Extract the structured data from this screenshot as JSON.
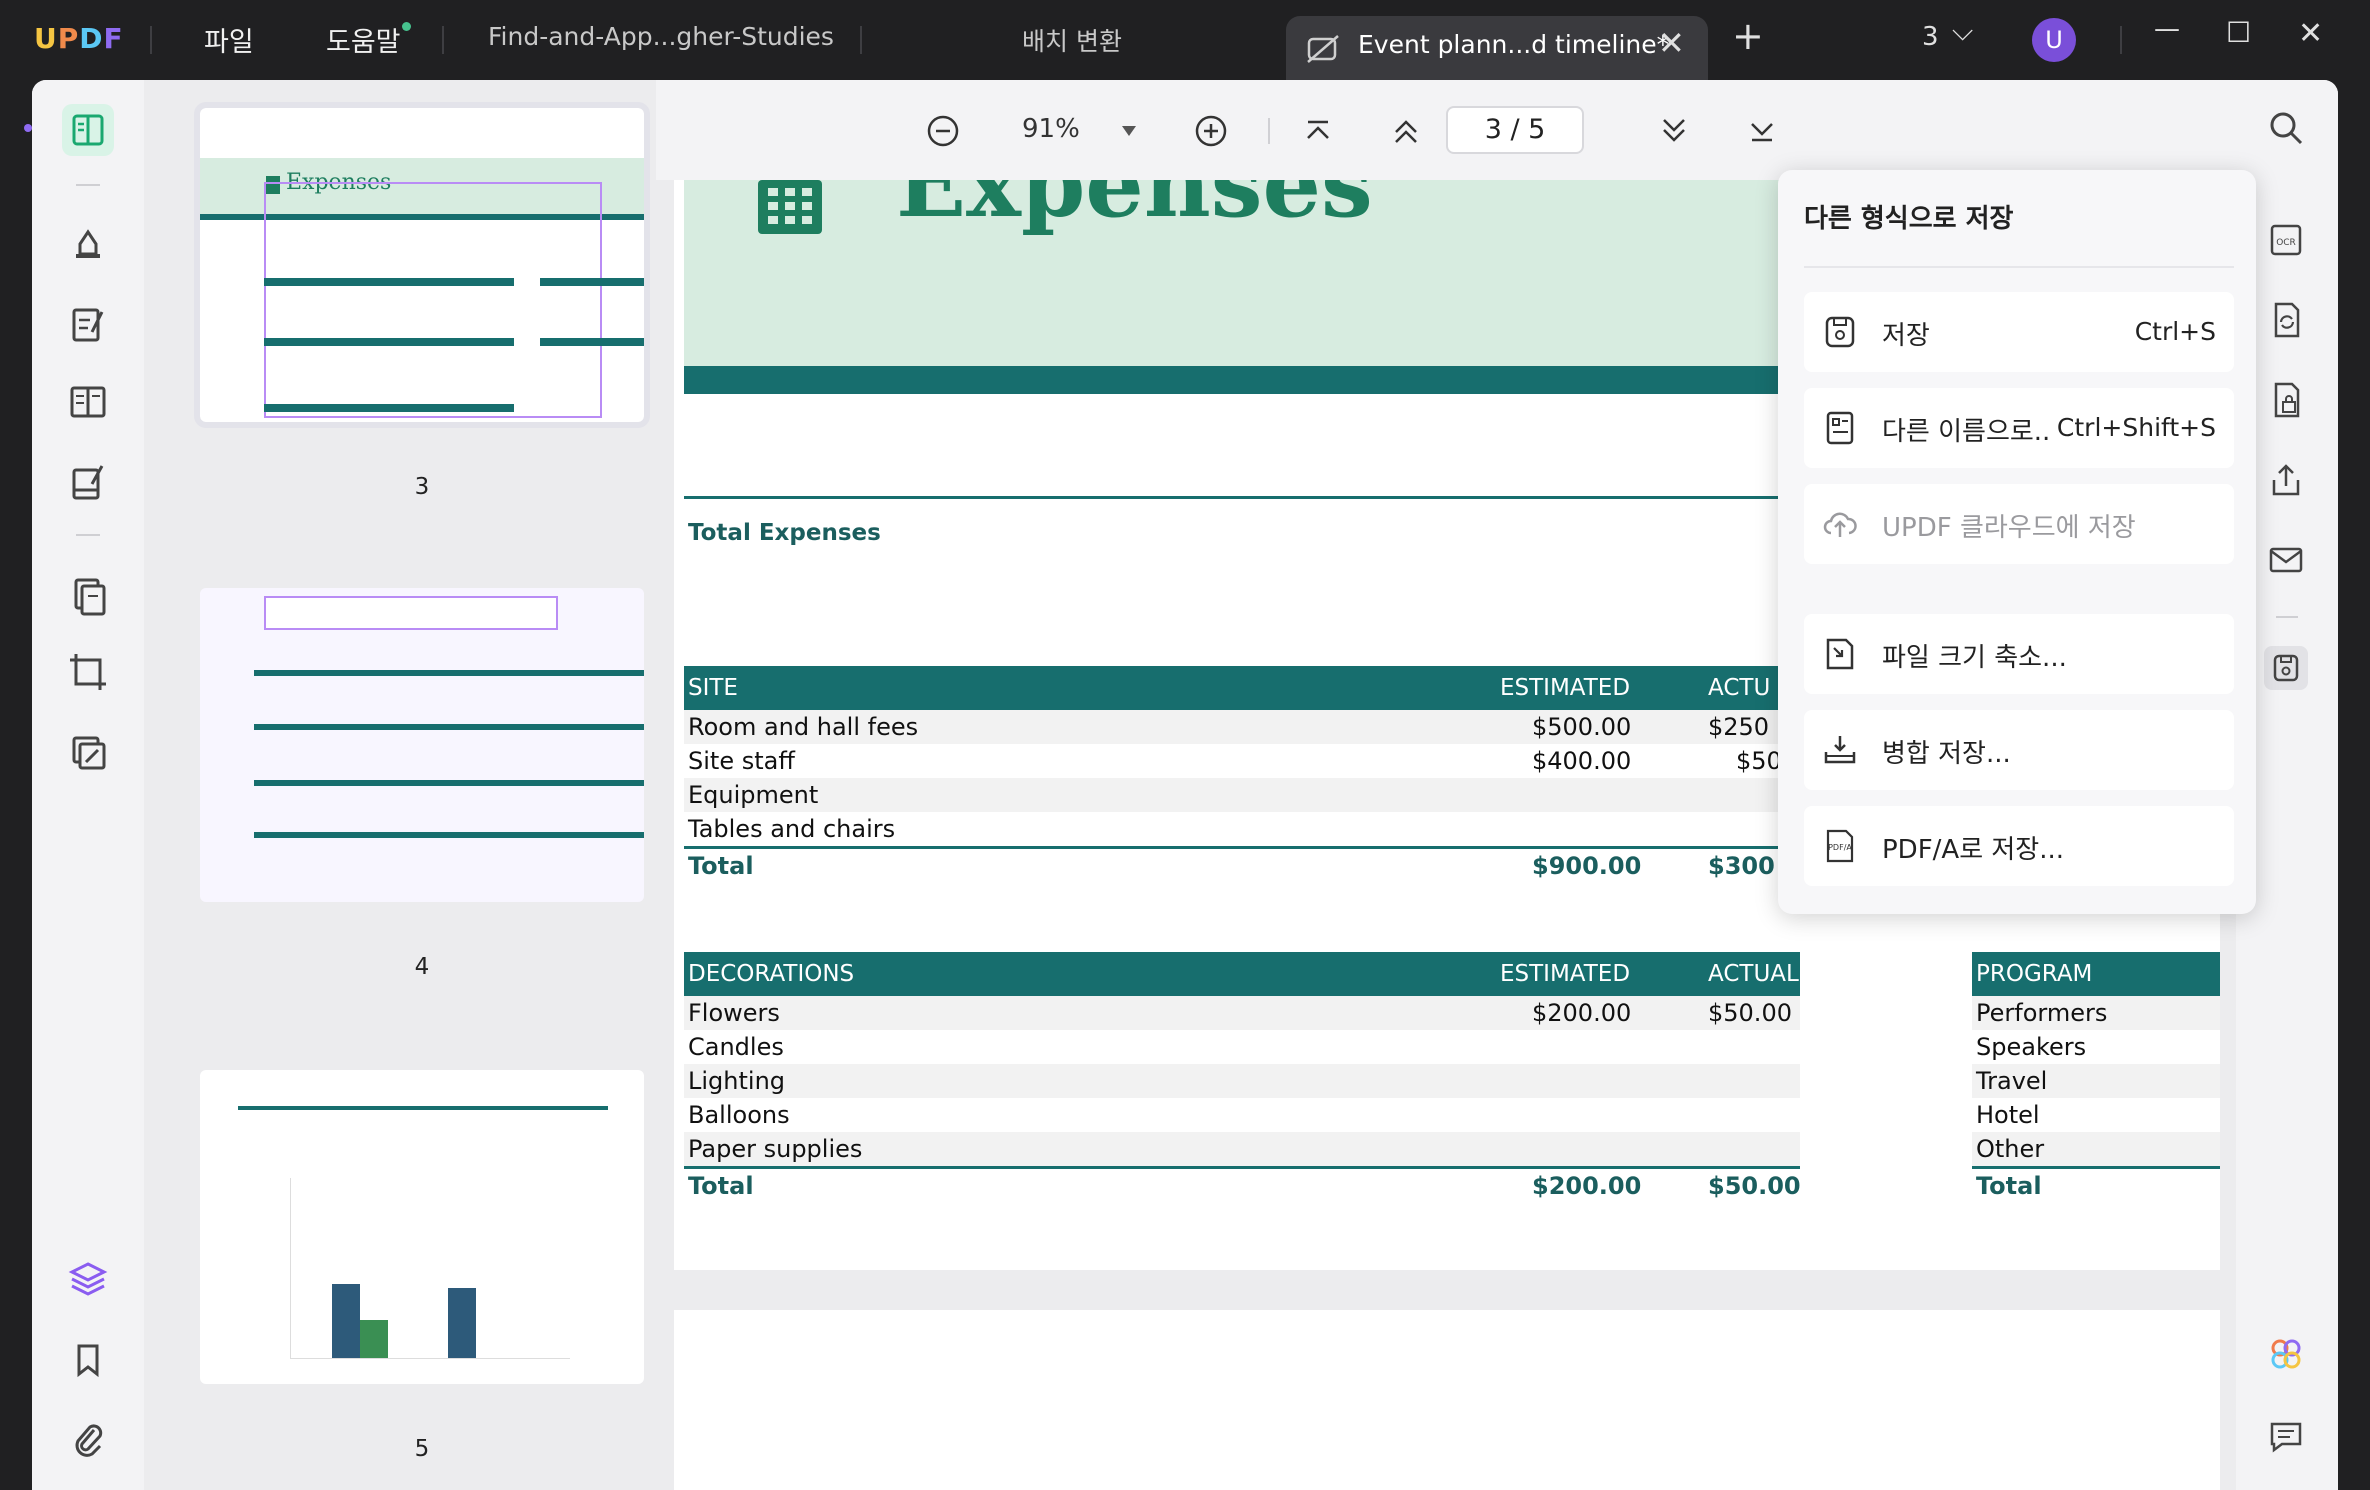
{
  "titlebar": {
    "logo": "UPDF",
    "menu_file": "파일",
    "menu_help": "도움말",
    "tab1": "Find-and-App...gher-Studies",
    "tab2": "배치 변환",
    "active_tab": "Event plann...d timeline*",
    "tab_count": "3",
    "avatar": "U",
    "close_glyph": "✕",
    "add_glyph": "+",
    "minimize_glyph": "—",
    "maximize_glyph": "☐",
    "chevron_glyph": "⌵"
  },
  "thumbnails": [
    {
      "page": "3",
      "title": "Expenses"
    },
    {
      "page": "4"
    },
    {
      "page": "5"
    }
  ],
  "toolbar": {
    "zoom": "91%",
    "page_indicator": "3 / 5"
  },
  "document": {
    "header_title": "Expenses",
    "total_expenses": "Total Expenses",
    "site_table": {
      "headers": [
        "SITE",
        "ESTIMATED",
        "ACTU"
      ],
      "rows": [
        [
          "Room and hall fees",
          "$500.00",
          "$250"
        ],
        [
          "Site staff",
          "$400.00",
          "$50"
        ],
        [
          "Equipment",
          "",
          ""
        ],
        [
          "Tables and chairs",
          "",
          ""
        ]
      ],
      "total": [
        "Total",
        "$900.00",
        "$300"
      ]
    },
    "decorations_table": {
      "headers": [
        "DECORATIONS",
        "ESTIMATED",
        "ACTUAL"
      ],
      "rows": [
        [
          "Flowers",
          "$200.00",
          "$50.00"
        ],
        [
          "Candles",
          "",
          ""
        ],
        [
          "Lighting",
          "",
          ""
        ],
        [
          "Balloons",
          "",
          ""
        ],
        [
          "Paper supplies",
          "",
          ""
        ]
      ],
      "total": [
        "Total",
        "$200.00",
        "$50.00"
      ]
    },
    "program_table": {
      "headers": [
        "PROGRAM"
      ],
      "rows": [
        [
          "Performers"
        ],
        [
          "Speakers"
        ],
        [
          "Travel"
        ],
        [
          "Hotel"
        ],
        [
          "Other"
        ]
      ],
      "total": [
        "Total"
      ]
    }
  },
  "save_menu": {
    "title": "다른 형식으로 저장",
    "items": [
      {
        "label": "저장",
        "shortcut": "Ctrl+S",
        "icon": "save-icon"
      },
      {
        "label": "다른 이름으로..",
        "shortcut": "Ctrl+Shift+S",
        "icon": "save-as-icon"
      },
      {
        "label": "UPDF 클라우드에 저장",
        "shortcut": "",
        "icon": "cloud-upload-icon"
      },
      {
        "label": "파일 크기 축소...",
        "shortcut": "",
        "icon": "compress-icon"
      },
      {
        "label": "병합 저장...",
        "shortcut": "",
        "icon": "flatten-save-icon"
      },
      {
        "label": "PDF/A로 저장...",
        "shortcut": "",
        "icon": "pdfa-icon"
      }
    ]
  },
  "colors": {
    "accent": "#176e6e",
    "header_band": "#d7ece0",
    "title_green": "#1e7e5f",
    "avatar": "#7a4fd9"
  }
}
